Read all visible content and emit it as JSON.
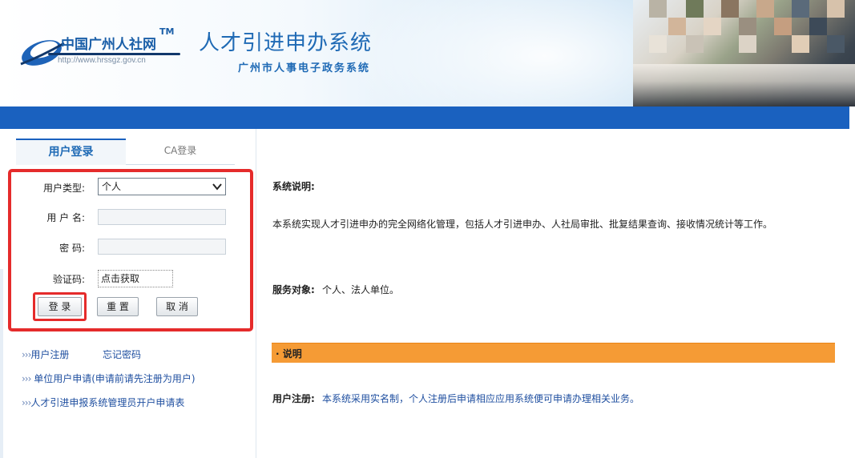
{
  "header": {
    "logo_text": "中国广州人社网",
    "logo_tm": "TM",
    "logo_url": "http://www.hrssgz.gov.cn",
    "system_title": "人才引进申办系统",
    "system_subtitle": "广州市人事电子政务系统"
  },
  "login": {
    "tabs": [
      {
        "label": "用户登录",
        "active": true
      },
      {
        "label": "CA登录",
        "active": false
      }
    ],
    "user_type_label": "用户类型:",
    "user_type_value": "个人",
    "username_label": "用 户 名:",
    "username_value": "",
    "password_label": "密  码:",
    "password_value": "",
    "captcha_label": "验证码:",
    "captcha_value": "点击获取",
    "buttons": {
      "login": "登  录",
      "reset": "重 置",
      "cancel": "取 消"
    },
    "highlight_color": "#e52b2b"
  },
  "links": {
    "arrow": "›››",
    "register": "用户注册",
    "forgot": "忘记密码",
    "org_apply": "单位用户申请(申请前请先注册为用户)",
    "admin_apply": "人才引进申报系统管理员开户申请表"
  },
  "content": {
    "desc_heading": "系统说明:",
    "desc_text": "本系统实现人才引进申办的完全网络化管理，包括人才引进申办、人社局审批、批复结果查询、接收情况统计等工作。",
    "service_label": "服务对象:",
    "service_text": "个人、法人单位。",
    "note_bar": "· 说明",
    "reg_label": "用户注册:",
    "reg_text": "本系统采用实名制，个人注册后申请相应应用系统便可申请办理相关业务。"
  },
  "colors": {
    "band_blue": "#1a61bf",
    "title_blue": "#1f6ab5",
    "note_orange": "#f59b35",
    "link_blue": "#1f4fa0"
  }
}
